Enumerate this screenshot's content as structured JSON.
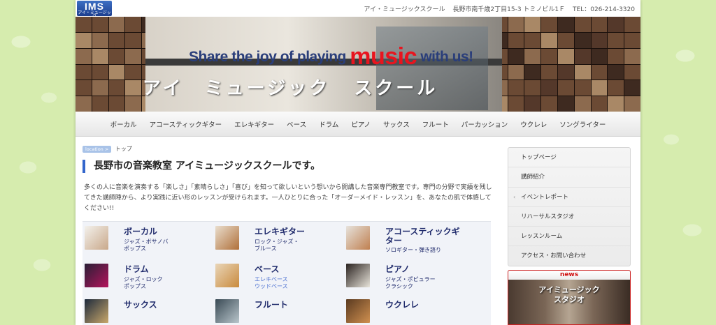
{
  "header": {
    "logo_text": "IMS",
    "logo_sub": "アイ・ミュージック",
    "school_name": "アイ・ミュージックスクール",
    "address": "長野市南千歳2丁目15-3 トミノビル1Ｆ",
    "tel": "TEL：026-214-3320"
  },
  "banner": {
    "slogan_a": "Share the joy of playing",
    "slogan_music": "music",
    "slogan_b": "with us!",
    "name_a": "アイ　ミュージック",
    "name_b": "スクール"
  },
  "nav": [
    "ボーカル",
    "アコースティックギター",
    "エレキギター",
    "ベース",
    "ドラム",
    "ピアノ",
    "サックス",
    "フルート",
    "パーカッション",
    "ウクレレ",
    "ソングライター"
  ],
  "breadcrumb": {
    "badge": "location >",
    "current": "トップ"
  },
  "main": {
    "title": "長野市の音楽教室 アイミュージックスクールです。",
    "intro": "多くの人に音楽を演奏する「楽しさ」「素晴らしさ」「喜び」を知って欲しいという想いから開講した音楽専門教室です。専門の分野で実績を残してきた講師陣から、より実践に近い形のレッスンが受けられます。一人ひとりに合った「オーダーメイド・レッスン」を、あなたの肌で体感してください!!"
  },
  "courses": [
    {
      "name": "ボーカル",
      "sub1": "ジャズ・ボサノバ",
      "sub2": "ポップス"
    },
    {
      "name": "エレキギター",
      "sub1": "ロック・ジャズ・",
      "sub2": "ブルース"
    },
    {
      "name": "アコースティックギター",
      "sub1": "ソロギター・弾き語り",
      "sub2": ""
    },
    {
      "name": "ドラム",
      "sub1": "ジャズ・ロック",
      "sub2": "ポップス"
    },
    {
      "name": "ベース",
      "sub1": "エレキベース",
      "sub2": "ウッドベース"
    },
    {
      "name": "ピアノ",
      "sub1": "ジャズ・ポピュラー",
      "sub2": "クラシック"
    },
    {
      "name": "サックス",
      "sub1": "",
      "sub2": ""
    },
    {
      "name": "フルート",
      "sub1": "",
      "sub2": ""
    },
    {
      "name": "ウクレレ",
      "sub1": "",
      "sub2": ""
    }
  ],
  "sidebar": [
    "トップページ",
    "講師紹介",
    "イベントレポート",
    "リハーサルスタジオ",
    "レッスンルーム",
    "アクセス・お問い合わせ"
  ],
  "news": {
    "label": "news",
    "caption_1": "アイミュージック",
    "caption_2": "スタジオ"
  },
  "colors": {
    "accent": "#3366cc",
    "course_name": "#1f2a6b",
    "news_red": "#d01010",
    "background": "#d6ecae"
  }
}
